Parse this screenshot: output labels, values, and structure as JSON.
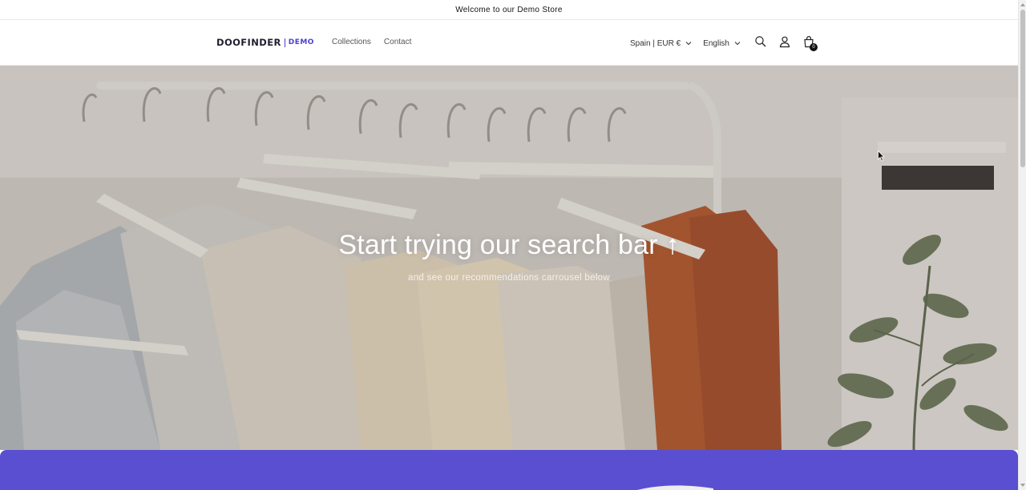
{
  "announcement": {
    "text": "Welcome to our Demo Store"
  },
  "header": {
    "logo": {
      "brand": "DOOFINDER",
      "tag": "DEMO"
    },
    "nav": [
      {
        "label": "Collections"
      },
      {
        "label": "Contact"
      }
    ],
    "country_selector": {
      "value": "Spain | EUR €"
    },
    "language_selector": {
      "value": "English"
    },
    "icons": {
      "search": "search-icon",
      "account": "account-icon",
      "cart": "cart-icon"
    },
    "cart_count": "0"
  },
  "hero": {
    "title": "Start trying our search bar ↑",
    "subtitle": "and see our recommendations carrousel below"
  },
  "colors": {
    "accent": "#5a4fd0",
    "logo_accent": "#4b3fd1",
    "text": "#121212"
  }
}
